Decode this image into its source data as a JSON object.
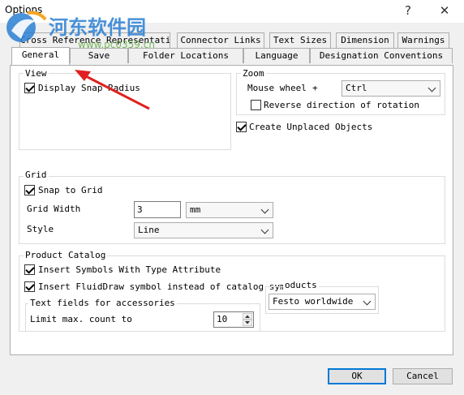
{
  "window": {
    "title": "Options",
    "help_label": "?",
    "close_label": "✕"
  },
  "tabs_row1": [
    "Cross Reference Representation",
    "Connector Links",
    "Text Sizes",
    "Dimension",
    "Warnings"
  ],
  "tabs_row2": [
    "General",
    "Save",
    "Folder Locations",
    "Language",
    "Designation Conventions"
  ],
  "view": {
    "legend": "View",
    "display_snap_radius": "Display Snap Radius"
  },
  "zoom": {
    "legend": "Zoom",
    "mouse_wheel_label": "Mouse wheel",
    "plus": "+",
    "modifier_value": "Ctrl",
    "reverse_label": "Reverse direction of rotation"
  },
  "create_unplaced": "Create Unplaced Objects",
  "grid": {
    "legend": "Grid",
    "snap_label": "Snap to Grid",
    "width_label": "Grid Width",
    "width_value": "3",
    "unit_value": "mm",
    "style_label": "Style",
    "style_value": "Line"
  },
  "catalog": {
    "legend": "Product Catalog",
    "insert_symbols": "Insert Symbols With Type Attribute",
    "insert_fluiddraw": "Insert FluidDraw symbol instead of catalog symbol",
    "products_fragment": "oducts",
    "products_value": "Festo worldwide",
    "accessories_legend": "Text fields for accessories",
    "limit_label": "Limit max. count to",
    "limit_value": "10"
  },
  "footer": {
    "ok_label": "OK",
    "cancel_label": "Cancel"
  },
  "watermark": {
    "site_name": "河东软件园",
    "url": "www.pc0359.cn"
  },
  "colors": {
    "accent": "#0078d7",
    "arrow": "#e02020",
    "watermark_text": "#2a7fd4"
  }
}
